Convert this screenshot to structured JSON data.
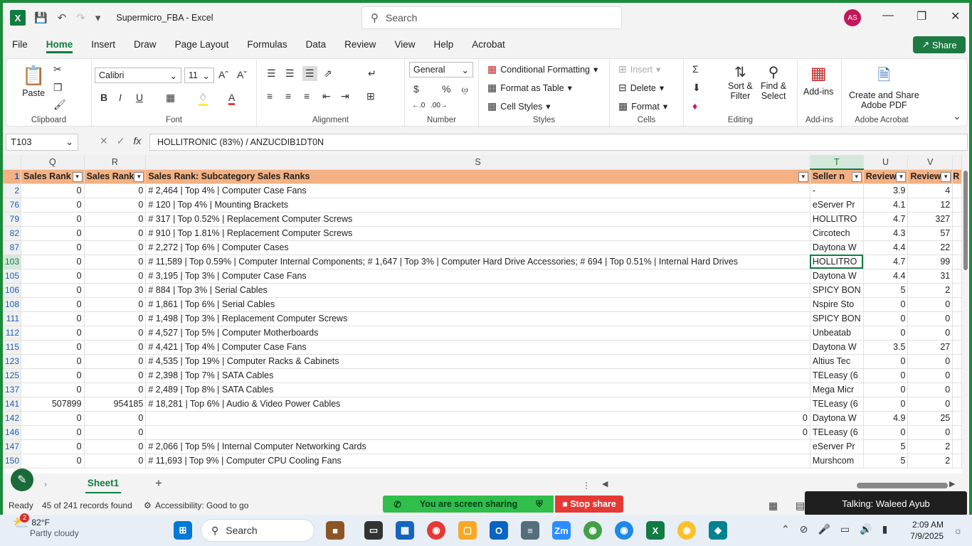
{
  "titlebar": {
    "app_icon": "X",
    "doc_title": "Supermicro_FBA  -  Excel",
    "search_placeholder": "Search",
    "avatar": "AS"
  },
  "menu": [
    "File",
    "Home",
    "Insert",
    "Draw",
    "Page Layout",
    "Formulas",
    "Data",
    "Review",
    "View",
    "Help",
    "Acrobat"
  ],
  "share_label": "Share",
  "ribbon": {
    "clipboard": {
      "paste": "Paste",
      "label": "Clipboard"
    },
    "font": {
      "name": "Calibri",
      "size": "11",
      "label": "Font"
    },
    "alignment": {
      "label": "Alignment"
    },
    "number": {
      "format": "General",
      "label": "Number"
    },
    "styles": {
      "cond": "Conditional Formatting",
      "table": "Format as Table",
      "cell": "Cell Styles",
      "label": "Styles"
    },
    "cells": {
      "insert": "Insert",
      "delete": "Delete",
      "format": "Format",
      "label": "Cells"
    },
    "editing": {
      "sort": "Sort &",
      "sort2": "Filter",
      "find": "Find &",
      "find2": "Select",
      "label": "Editing"
    },
    "addins": {
      "btn": "Add-ins",
      "label": "Add-ins"
    },
    "acrobat": {
      "btn1": "Create and Share",
      "btn2": "Adobe PDF",
      "label": "Adobe Acrobat"
    }
  },
  "formula_bar": {
    "name_box": "T103",
    "content": "HOLLITRONIC (83%) / ANZUCDIB1DT0N"
  },
  "columns": [
    "Q",
    "R",
    "S",
    "T",
    "U",
    "V"
  ],
  "header_row": {
    "row": "1",
    "q": "Sales Rank",
    "r": "Sales Rank",
    "s": "Sales Rank: Subcategory Sales Ranks",
    "t": "Seller n",
    "u": "Review",
    "v": "Review",
    "w": "R"
  },
  "rows": [
    {
      "n": "2",
      "q": "0",
      "r": "0",
      "s": "# 2,464  |  Top 4%  |  Computer Case Fans",
      "t": "-",
      "u": "3.9",
      "v": "4"
    },
    {
      "n": "76",
      "q": "0",
      "r": "0",
      "s": "# 120  |  Top 4%  |  Mounting Brackets",
      "t": "eServer Pr",
      "u": "4.1",
      "v": "12"
    },
    {
      "n": "79",
      "q": "0",
      "r": "0",
      "s": "# 317  |  Top 0.52%  |  Replacement Computer Screws",
      "t": "HOLLITRO",
      "u": "4.7",
      "v": "327"
    },
    {
      "n": "82",
      "q": "0",
      "r": "0",
      "s": "# 910  |  Top 1.81%  |  Replacement Computer Screws",
      "t": "Circotech",
      "u": "4.3",
      "v": "57"
    },
    {
      "n": "87",
      "q": "0",
      "r": "0",
      "s": "# 2,272  |  Top 6%  |  Computer Cases",
      "t": "Daytona W",
      "u": "4.4",
      "v": "22"
    },
    {
      "n": "103",
      "q": "0",
      "r": "0",
      "s": "# 11,589  |  Top 0.59%  |  Computer Internal Components; # 1,647  |  Top 3%  |  Computer Hard Drive Accessories; # 694  |  Top 0.51%  |  Internal Hard Drives",
      "t": "HOLLITRO",
      "u": "4.7",
      "v": "99"
    },
    {
      "n": "105",
      "q": "0",
      "r": "0",
      "s": "# 3,195  |  Top 3%  |  Computer Case Fans",
      "t": "Daytona W",
      "u": "4.4",
      "v": "31"
    },
    {
      "n": "106",
      "q": "0",
      "r": "0",
      "s": "# 884  |  Top 3%  |  Serial Cables",
      "t": "SPICY BON",
      "u": "5",
      "v": "2"
    },
    {
      "n": "108",
      "q": "0",
      "r": "0",
      "s": "# 1,861  |  Top 6%  |  Serial Cables",
      "t": "Nspire Sto",
      "u": "0",
      "v": "0"
    },
    {
      "n": "111",
      "q": "0",
      "r": "0",
      "s": "# 1,498  |  Top 3%  |  Replacement Computer Screws",
      "t": "SPICY BON",
      "u": "0",
      "v": "0"
    },
    {
      "n": "112",
      "q": "0",
      "r": "0",
      "s": "# 4,527  |  Top 5%  |  Computer Motherboards",
      "t": "Unbeatab",
      "u": "0",
      "v": "0"
    },
    {
      "n": "115",
      "q": "0",
      "r": "0",
      "s": "# 4,421  |  Top 4%  |  Computer Case Fans",
      "t": "Daytona W",
      "u": "3.5",
      "v": "27"
    },
    {
      "n": "123",
      "q": "0",
      "r": "0",
      "s": "# 4,535  |  Top 19%  |  Computer Racks & Cabinets",
      "t": "Altius Tec",
      "u": "0",
      "v": "0"
    },
    {
      "n": "125",
      "q": "0",
      "r": "0",
      "s": "# 2,398  |  Top 7%  |  SATA Cables",
      "t": "TELeasy (6",
      "u": "0",
      "v": "0"
    },
    {
      "n": "137",
      "q": "0",
      "r": "0",
      "s": "# 2,489  |  Top 8%  |  SATA Cables",
      "t": "Mega Micr",
      "u": "0",
      "v": "0"
    },
    {
      "n": "141",
      "q": "507899",
      "r": "954185",
      "s": "# 18,281  |  Top 6%  |  Audio & Video Power Cables",
      "t": "TELeasy (6",
      "u": "0",
      "v": "0"
    },
    {
      "n": "142",
      "q": "0",
      "r": "0",
      "s": "0",
      "t": "Daytona W",
      "u": "4.9",
      "v": "25"
    },
    {
      "n": "146",
      "q": "0",
      "r": "0",
      "s": "0",
      "t": "TELeasy (6",
      "u": "0",
      "v": "0"
    },
    {
      "n": "147",
      "q": "0",
      "r": "0",
      "s": "# 2,066  |  Top 5%  |  Internal Computer Networking Cards",
      "t": "eServer Pr",
      "u": "5",
      "v": "2"
    },
    {
      "n": "150",
      "q": "0",
      "r": "0",
      "s": "# 11,693  |  Top 9%  |  Computer CPU Cooling Fans",
      "t": "Murshcom",
      "u": "5",
      "v": "2"
    }
  ],
  "sheet": {
    "tab": "Sheet1"
  },
  "status": {
    "ready": "Ready",
    "records": "45 of 241 records found",
    "accessibility": "Accessibility: Good to go"
  },
  "sharing": {
    "msg": "You are screen sharing",
    "stop": "Stop share",
    "talking": "Talking: Waleed Ayub"
  },
  "taskbar": {
    "temp": "82°F",
    "weather": "Partly cloudy",
    "search": "Search",
    "time": "2:09 AM",
    "date": "7/9/2025",
    "notif": "2"
  },
  "colors": {
    "excel_green": "#107c41",
    "header_fill": "#f4b183",
    "taskbar_bg": "#e7eef6"
  }
}
